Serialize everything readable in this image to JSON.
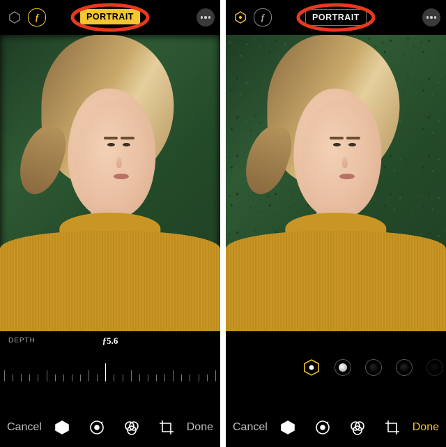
{
  "left": {
    "portrait_label": "PORTRAIT",
    "portrait_state": "on",
    "f_glyph": "f",
    "depth_label": "DEPTH",
    "f_value": "ƒ5.6",
    "cancel": "Cancel",
    "done": "Done",
    "done_accent": false,
    "tools": [
      "lighting-icon",
      "adjust-icon",
      "filters-icon",
      "crop-icon"
    ]
  },
  "right": {
    "portrait_label": "PORTRAIT",
    "portrait_state": "off",
    "f_glyph": "f",
    "cancel": "Cancel",
    "done": "Done",
    "done_accent": true,
    "tools": [
      "lighting-icon",
      "adjust-icon",
      "filters-icon",
      "crop-icon"
    ],
    "lighting_styles": [
      "natural",
      "studio",
      "contour",
      "stage",
      "stage-mono"
    ]
  },
  "colors": {
    "accent": "#f4c631",
    "highlight": "#e63a1e"
  }
}
